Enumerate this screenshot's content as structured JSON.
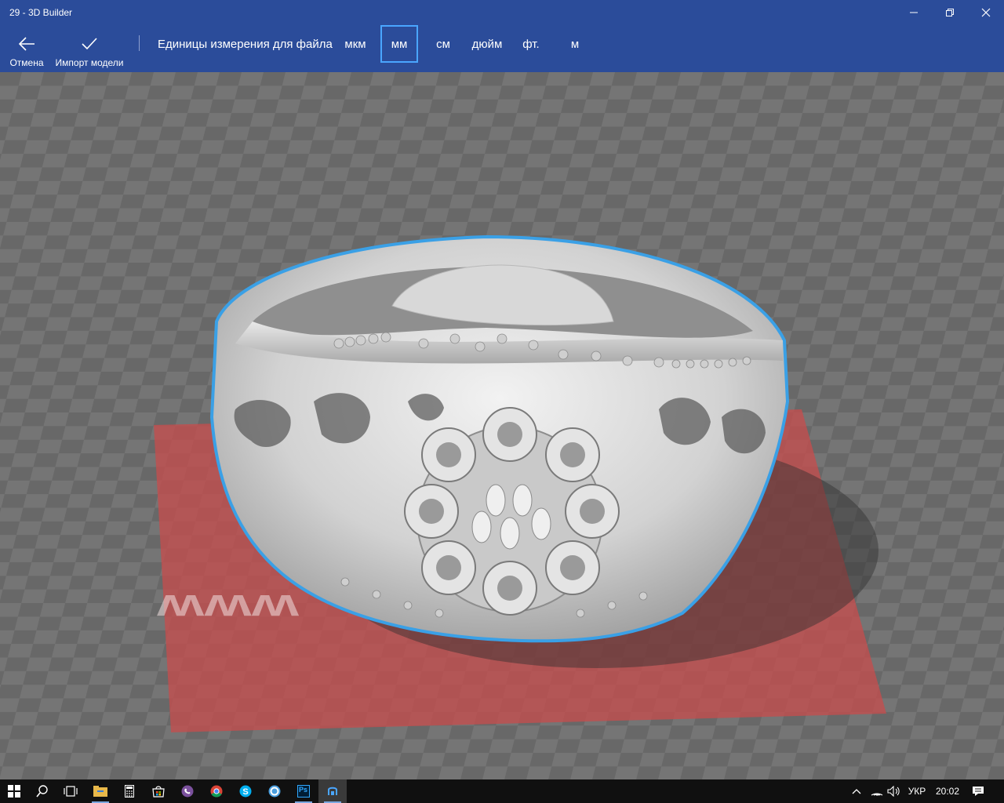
{
  "window": {
    "title": "29 - 3D Builder",
    "controls": [
      "minimize-icon",
      "restore-icon",
      "close-icon"
    ]
  },
  "toolbar": {
    "cancel_label": "Отмена",
    "import_label": "Импорт модели",
    "units_label": "Единицы измерения для файла",
    "units": [
      {
        "label": "мкм",
        "selected": false
      },
      {
        "label": "мм",
        "selected": true
      },
      {
        "label": "см",
        "selected": false
      },
      {
        "label": "дюйм",
        "selected": false
      },
      {
        "label": "фт.",
        "selected": false
      },
      {
        "label": "м",
        "selected": false
      }
    ]
  },
  "viewport": {
    "watermark": "WWW",
    "colors": {
      "toolbar": "#2b4c9a",
      "selection_outline": "#3aa0e6",
      "build_plate": "#c44d4d",
      "checker_light": "#7a7a7a",
      "checker_dark": "#6a6a6a"
    }
  },
  "taskbar": {
    "apps": [
      {
        "name": "start-icon"
      },
      {
        "name": "search-icon"
      },
      {
        "name": "task-view-icon"
      },
      {
        "name": "file-explorer-icon"
      },
      {
        "name": "calculator-icon"
      },
      {
        "name": "store-icon"
      },
      {
        "name": "viber-icon"
      },
      {
        "name": "chrome-icon"
      },
      {
        "name": "skype-icon"
      },
      {
        "name": "app-ring-icon"
      },
      {
        "name": "photoshop-icon",
        "label": "Ps"
      },
      {
        "name": "3d-builder-icon"
      }
    ],
    "tray": {
      "language": "УКР",
      "time": "20:02"
    }
  }
}
